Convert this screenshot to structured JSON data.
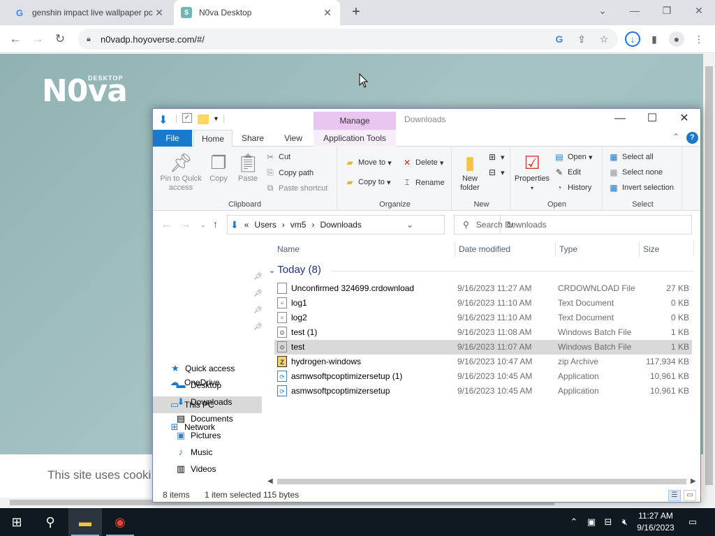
{
  "browser": {
    "tabs": [
      {
        "title": "genshin impact live wallpaper pc",
        "favicon": "google-icon"
      },
      {
        "title": "N0va Desktop",
        "favicon": "hoyoverse-icon"
      }
    ],
    "url": "n0vadp.hoyoverse.com/#/"
  },
  "page": {
    "logo_text": "N0va",
    "logo_sub": "DESKTOP",
    "cookie_text": "This site uses cooki"
  },
  "explorer": {
    "caption": "Downloads",
    "manage_label": "Manage",
    "ribbon_tabs": {
      "file": "File",
      "home": "Home",
      "share": "Share",
      "view": "View",
      "app_tools": "Application Tools"
    },
    "clipboard": {
      "label": "Clipboard",
      "pin": "Pin to Quick access",
      "copy": "Copy",
      "paste": "Paste",
      "cut": "Cut",
      "copy_path": "Copy path",
      "paste_shortcut": "Paste shortcut"
    },
    "organize": {
      "label": "Organize",
      "move_to": "Move to",
      "copy_to": "Copy to",
      "delete": "Delete",
      "rename": "Rename"
    },
    "new": {
      "label": "New",
      "new_folder": "New folder"
    },
    "open": {
      "label": "Open",
      "properties": "Properties",
      "open": "Open",
      "edit": "Edit",
      "history": "History"
    },
    "select": {
      "label": "Select",
      "select_all": "Select all",
      "select_none": "Select none",
      "invert": "Invert selection"
    },
    "address": {
      "prefix": "«",
      "parts": [
        "Users",
        "vm5",
        "Downloads"
      ]
    },
    "search_placeholder": "Search Downloads",
    "nav": {
      "quick_access": "Quick access",
      "desktop": "Desktop",
      "downloads": "Downloads",
      "documents": "Documents",
      "pictures": "Pictures",
      "music": "Music",
      "videos": "Videos",
      "onedrive": "OneDrive",
      "this_pc": "This PC",
      "network": "Network"
    },
    "columns": {
      "name": "Name",
      "date": "Date modified",
      "type": "Type",
      "size": "Size"
    },
    "group": "Today (8)",
    "files": [
      {
        "name": "Unconfirmed 324699.crdownload",
        "date": "9/16/2023 11:27 AM",
        "type": "CRDOWNLOAD File",
        "size": "27 KB",
        "icon": "file-icon"
      },
      {
        "name": "log1",
        "date": "9/16/2023 11:10 AM",
        "type": "Text Document",
        "size": "0 KB",
        "icon": "text-file-icon"
      },
      {
        "name": "log2",
        "date": "9/16/2023 11:10 AM",
        "type": "Text Document",
        "size": "0 KB",
        "icon": "text-file-icon"
      },
      {
        "name": "test (1)",
        "date": "9/16/2023 11:08 AM",
        "type": "Windows Batch File",
        "size": "1 KB",
        "icon": "batch-file-icon"
      },
      {
        "name": "test",
        "date": "9/16/2023 11:07 AM",
        "type": "Windows Batch File",
        "size": "1 KB",
        "icon": "batch-file-icon"
      },
      {
        "name": "hydrogen-windows",
        "date": "9/16/2023 10:47 AM",
        "type": "zip Archive",
        "size": "117,934 KB",
        "icon": "zip-icon"
      },
      {
        "name": "asmwsoftpcoptimizersetup (1)",
        "date": "9/16/2023 10:45 AM",
        "type": "Application",
        "size": "10,961 KB",
        "icon": "installer-icon"
      },
      {
        "name": "asmwsoftpcoptimizersetup",
        "date": "9/16/2023 10:45 AM",
        "type": "Application",
        "size": "10,961 KB",
        "icon": "installer-icon"
      }
    ],
    "status": {
      "items": "8 items",
      "selected": "1 item selected",
      "size": "115 bytes"
    }
  },
  "taskbar": {
    "time": "11:27 AM",
    "date": "9/16/2023"
  },
  "colors": {
    "accent": "#1979ca",
    "manage_bg": "#e9c6ef",
    "taskbar": "#101820"
  }
}
